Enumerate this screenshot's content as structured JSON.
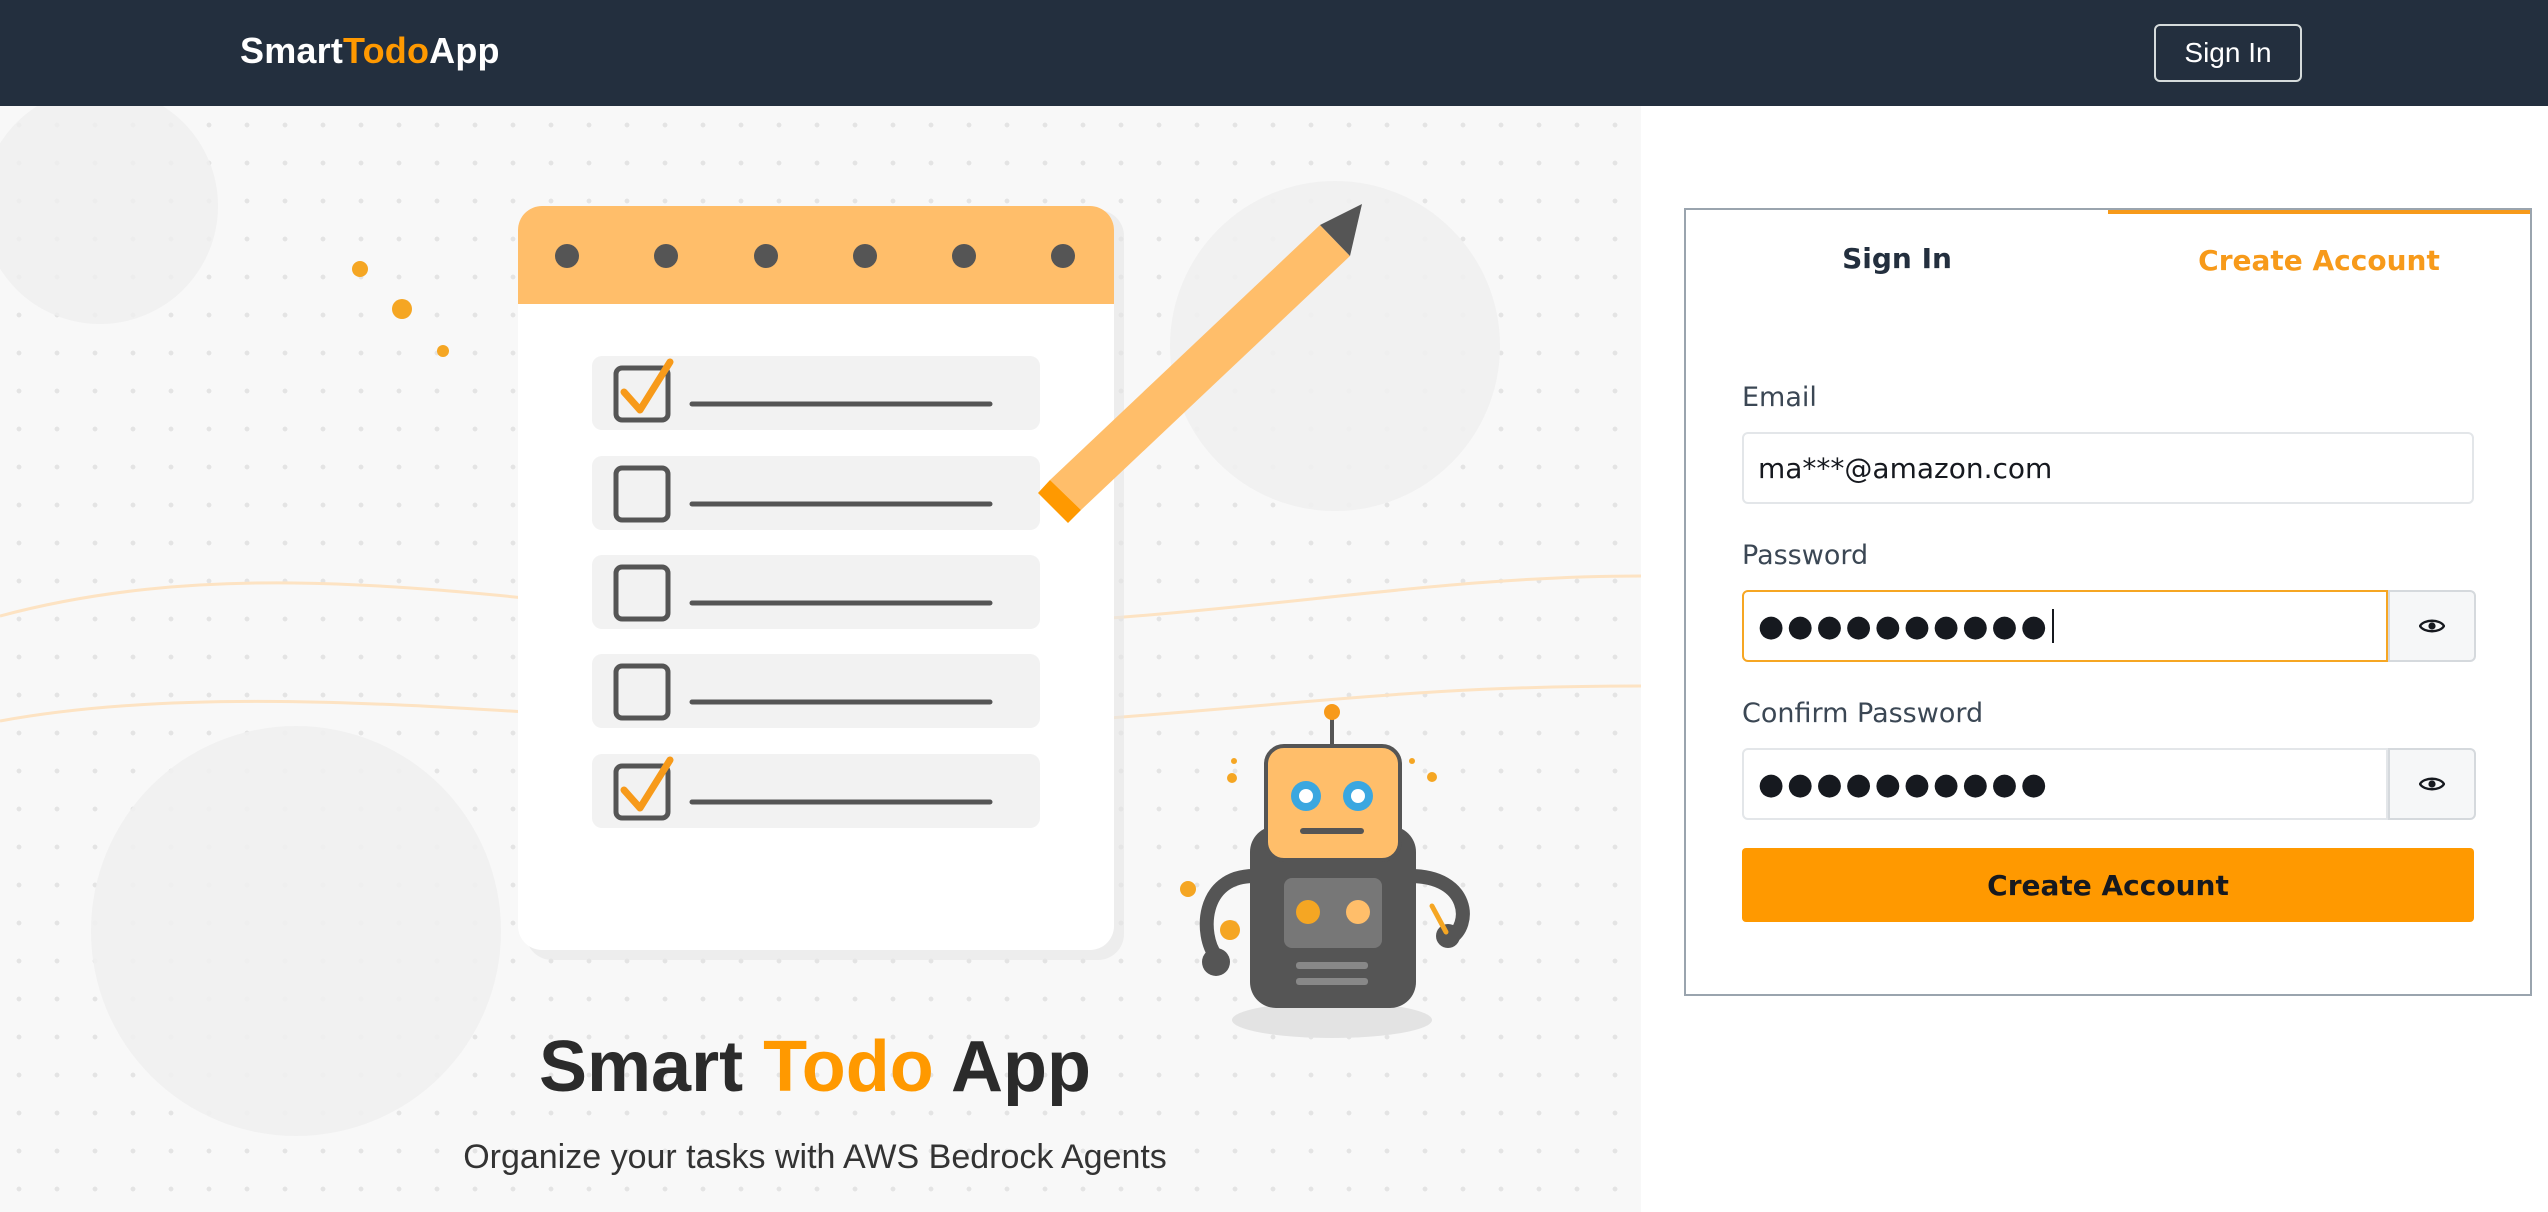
{
  "header": {
    "brand_part1": "Smart",
    "brand_part2": "Todo",
    "brand_part3": "App",
    "signin_label": "Sign In"
  },
  "hero": {
    "title_part1": "Smart ",
    "title_part2": "Todo",
    "title_part3": " App",
    "subtitle": "Organize your tasks with AWS Bedrock Agents"
  },
  "auth": {
    "tabs": [
      {
        "label": "Sign In",
        "active": false
      },
      {
        "label": "Create Account",
        "active": true
      }
    ],
    "email_label": "Email",
    "email_value": "ma***@amazon.com",
    "password_label": "Password",
    "password_value": "●●●●●●●●●●",
    "confirm_label": "Confirm Password",
    "confirm_value": "●●●●●●●●●●",
    "submit_label": "Create Account",
    "eye_icon": "eye-icon"
  },
  "colors": {
    "header_bg": "#232f3e",
    "accent": "#ff9900"
  }
}
